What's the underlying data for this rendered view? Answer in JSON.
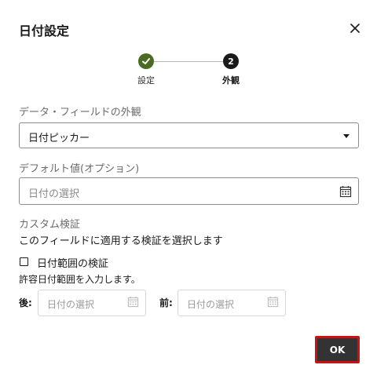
{
  "dialog": {
    "title": "日付設定"
  },
  "stepper": {
    "steps": [
      {
        "label": "設定",
        "state": "completed"
      },
      {
        "label": "外観",
        "number": "2",
        "state": "active"
      }
    ],
    "completed_color": "#4a6b23"
  },
  "appearance": {
    "label": "データ・フィールドの外観",
    "value": "日付ピッカー"
  },
  "default_value": {
    "label": "デフォルト値(オプション)",
    "placeholder": "日付の選択"
  },
  "validation": {
    "label": "カスタム検証",
    "description": "このフィールドに適用する検証を選択します",
    "checkbox_label": "日付範囲の検証",
    "checkbox_checked": false,
    "range_hint": "許容日付範囲を入力します。",
    "after_label": "後:",
    "after_placeholder": "日付の選択",
    "before_label": "前:",
    "before_placeholder": "日付の選択"
  },
  "footer": {
    "ok_label": "OK",
    "ok_highlight_color": "#d01010"
  },
  "icons": [
    "close-icon",
    "checkmark-icon",
    "chevron-down-icon",
    "calendar-icon"
  ]
}
